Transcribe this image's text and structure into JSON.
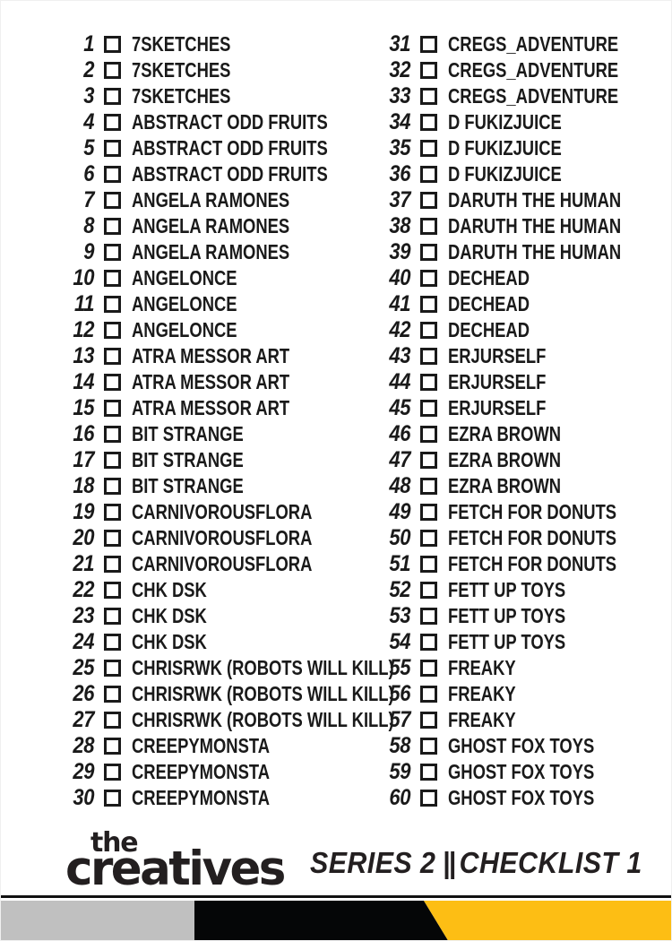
{
  "card": {
    "title_series": "SERIES 2",
    "separator": "||",
    "title_checklist": "CHECKLIST 1",
    "logo_top": "the",
    "logo_main": "creatives"
  },
  "colors": {
    "ink": "#1a1a1a",
    "logo_ink": "#231f20",
    "bar_gray": "#c0c0c0",
    "bar_black": "#050607",
    "bar_yellow": "#fdbe14"
  },
  "checklist": {
    "left_column": [
      {
        "number": "1",
        "label": "7SKETCHES"
      },
      {
        "number": "2",
        "label": "7SKETCHES"
      },
      {
        "number": "3",
        "label": "7SKETCHES"
      },
      {
        "number": "4",
        "label": "ABSTRACT ODD FRUITS"
      },
      {
        "number": "5",
        "label": "ABSTRACT ODD FRUITS"
      },
      {
        "number": "6",
        "label": "ABSTRACT ODD FRUITS"
      },
      {
        "number": "7",
        "label": "ANGELA RAMONES"
      },
      {
        "number": "8",
        "label": "ANGELA RAMONES"
      },
      {
        "number": "9",
        "label": "ANGELA RAMONES"
      },
      {
        "number": "10",
        "label": "ANGELONCE"
      },
      {
        "number": "11",
        "label": "ANGELONCE"
      },
      {
        "number": "12",
        "label": "ANGELONCE"
      },
      {
        "number": "13",
        "label": "ATRA MESSOR ART"
      },
      {
        "number": "14",
        "label": "ATRA MESSOR ART"
      },
      {
        "number": "15",
        "label": "ATRA MESSOR ART"
      },
      {
        "number": "16",
        "label": "BIT STRANGE"
      },
      {
        "number": "17",
        "label": "BIT STRANGE"
      },
      {
        "number": "18",
        "label": "BIT STRANGE"
      },
      {
        "number": "19",
        "label": "CARNIVOROUSFLORA"
      },
      {
        "number": "20",
        "label": "CARNIVOROUSFLORA"
      },
      {
        "number": "21",
        "label": "CARNIVOROUSFLORA"
      },
      {
        "number": "22",
        "label": "CHK DSK"
      },
      {
        "number": "23",
        "label": "CHK DSK"
      },
      {
        "number": "24",
        "label": "CHK DSK"
      },
      {
        "number": "25",
        "label": "CHRISRWK (ROBOTS WILL KILL)"
      },
      {
        "number": "26",
        "label": "CHRISRWK (ROBOTS WILL KILL)"
      },
      {
        "number": "27",
        "label": "CHRISRWK (ROBOTS WILL KILL)"
      },
      {
        "number": "28",
        "label": "CREEPYMONSTA"
      },
      {
        "number": "29",
        "label": "CREEPYMONSTA"
      },
      {
        "number": "30",
        "label": "CREEPYMONSTA"
      }
    ],
    "right_column": [
      {
        "number": "31",
        "label": "CREGS_ADVENTURE"
      },
      {
        "number": "32",
        "label": "CREGS_ADVENTURE"
      },
      {
        "number": "33",
        "label": "CREGS_ADVENTURE"
      },
      {
        "number": "34",
        "label": "D FUKIZJUICE"
      },
      {
        "number": "35",
        "label": "D FUKIZJUICE"
      },
      {
        "number": "36",
        "label": "D FUKIZJUICE"
      },
      {
        "number": "37",
        "label": "DARUTH THE HUMAN"
      },
      {
        "number": "38",
        "label": "DARUTH THE HUMAN"
      },
      {
        "number": "39",
        "label": "DARUTH THE HUMAN"
      },
      {
        "number": "40",
        "label": "DECHEAD"
      },
      {
        "number": "41",
        "label": "DECHEAD"
      },
      {
        "number": "42",
        "label": "DECHEAD"
      },
      {
        "number": "43",
        "label": "ERJURSELF"
      },
      {
        "number": "44",
        "label": "ERJURSELF"
      },
      {
        "number": "45",
        "label": "ERJURSELF"
      },
      {
        "number": "46",
        "label": "EZRA BROWN"
      },
      {
        "number": "47",
        "label": "EZRA BROWN"
      },
      {
        "number": "48",
        "label": "EZRA BROWN"
      },
      {
        "number": "49",
        "label": "FETCH FOR DONUTS"
      },
      {
        "number": "50",
        "label": "FETCH FOR DONUTS"
      },
      {
        "number": "51",
        "label": "FETCH FOR DONUTS"
      },
      {
        "number": "52",
        "label": "FETT UP TOYS"
      },
      {
        "number": "53",
        "label": "FETT UP TOYS"
      },
      {
        "number": "54",
        "label": "FETT UP TOYS"
      },
      {
        "number": "55",
        "label": "FREAKY"
      },
      {
        "number": "56",
        "label": "FREAKY"
      },
      {
        "number": "57",
        "label": "FREAKY"
      },
      {
        "number": "58",
        "label": "GHOST FOX TOYS"
      },
      {
        "number": "59",
        "label": "GHOST FOX TOYS"
      },
      {
        "number": "60",
        "label": "GHOST FOX TOYS"
      }
    ]
  }
}
